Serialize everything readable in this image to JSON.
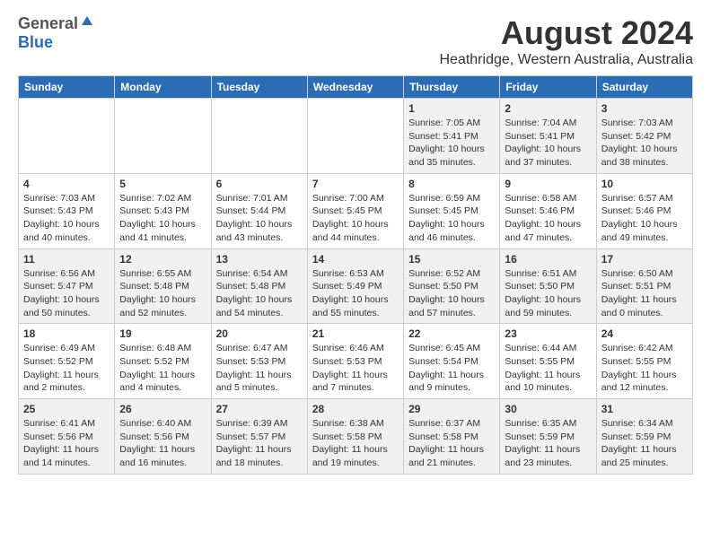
{
  "header": {
    "logo_general": "General",
    "logo_blue": "Blue",
    "month_year": "August 2024",
    "location": "Heathridge, Western Australia, Australia"
  },
  "days_of_week": [
    "Sunday",
    "Monday",
    "Tuesday",
    "Wednesday",
    "Thursday",
    "Friday",
    "Saturday"
  ],
  "weeks": [
    [
      {
        "day": "",
        "info": ""
      },
      {
        "day": "",
        "info": ""
      },
      {
        "day": "",
        "info": ""
      },
      {
        "day": "",
        "info": ""
      },
      {
        "day": "1",
        "info": "Sunrise: 7:05 AM\nSunset: 5:41 PM\nDaylight: 10 hours\nand 35 minutes."
      },
      {
        "day": "2",
        "info": "Sunrise: 7:04 AM\nSunset: 5:41 PM\nDaylight: 10 hours\nand 37 minutes."
      },
      {
        "day": "3",
        "info": "Sunrise: 7:03 AM\nSunset: 5:42 PM\nDaylight: 10 hours\nand 38 minutes."
      }
    ],
    [
      {
        "day": "4",
        "info": "Sunrise: 7:03 AM\nSunset: 5:43 PM\nDaylight: 10 hours\nand 40 minutes."
      },
      {
        "day": "5",
        "info": "Sunrise: 7:02 AM\nSunset: 5:43 PM\nDaylight: 10 hours\nand 41 minutes."
      },
      {
        "day": "6",
        "info": "Sunrise: 7:01 AM\nSunset: 5:44 PM\nDaylight: 10 hours\nand 43 minutes."
      },
      {
        "day": "7",
        "info": "Sunrise: 7:00 AM\nSunset: 5:45 PM\nDaylight: 10 hours\nand 44 minutes."
      },
      {
        "day": "8",
        "info": "Sunrise: 6:59 AM\nSunset: 5:45 PM\nDaylight: 10 hours\nand 46 minutes."
      },
      {
        "day": "9",
        "info": "Sunrise: 6:58 AM\nSunset: 5:46 PM\nDaylight: 10 hours\nand 47 minutes."
      },
      {
        "day": "10",
        "info": "Sunrise: 6:57 AM\nSunset: 5:46 PM\nDaylight: 10 hours\nand 49 minutes."
      }
    ],
    [
      {
        "day": "11",
        "info": "Sunrise: 6:56 AM\nSunset: 5:47 PM\nDaylight: 10 hours\nand 50 minutes."
      },
      {
        "day": "12",
        "info": "Sunrise: 6:55 AM\nSunset: 5:48 PM\nDaylight: 10 hours\nand 52 minutes."
      },
      {
        "day": "13",
        "info": "Sunrise: 6:54 AM\nSunset: 5:48 PM\nDaylight: 10 hours\nand 54 minutes."
      },
      {
        "day": "14",
        "info": "Sunrise: 6:53 AM\nSunset: 5:49 PM\nDaylight: 10 hours\nand 55 minutes."
      },
      {
        "day": "15",
        "info": "Sunrise: 6:52 AM\nSunset: 5:50 PM\nDaylight: 10 hours\nand 57 minutes."
      },
      {
        "day": "16",
        "info": "Sunrise: 6:51 AM\nSunset: 5:50 PM\nDaylight: 10 hours\nand 59 minutes."
      },
      {
        "day": "17",
        "info": "Sunrise: 6:50 AM\nSunset: 5:51 PM\nDaylight: 11 hours\nand 0 minutes."
      }
    ],
    [
      {
        "day": "18",
        "info": "Sunrise: 6:49 AM\nSunset: 5:52 PM\nDaylight: 11 hours\nand 2 minutes."
      },
      {
        "day": "19",
        "info": "Sunrise: 6:48 AM\nSunset: 5:52 PM\nDaylight: 11 hours\nand 4 minutes."
      },
      {
        "day": "20",
        "info": "Sunrise: 6:47 AM\nSunset: 5:53 PM\nDaylight: 11 hours\nand 5 minutes."
      },
      {
        "day": "21",
        "info": "Sunrise: 6:46 AM\nSunset: 5:53 PM\nDaylight: 11 hours\nand 7 minutes."
      },
      {
        "day": "22",
        "info": "Sunrise: 6:45 AM\nSunset: 5:54 PM\nDaylight: 11 hours\nand 9 minutes."
      },
      {
        "day": "23",
        "info": "Sunrise: 6:44 AM\nSunset: 5:55 PM\nDaylight: 11 hours\nand 10 minutes."
      },
      {
        "day": "24",
        "info": "Sunrise: 6:42 AM\nSunset: 5:55 PM\nDaylight: 11 hours\nand 12 minutes."
      }
    ],
    [
      {
        "day": "25",
        "info": "Sunrise: 6:41 AM\nSunset: 5:56 PM\nDaylight: 11 hours\nand 14 minutes."
      },
      {
        "day": "26",
        "info": "Sunrise: 6:40 AM\nSunset: 5:56 PM\nDaylight: 11 hours\nand 16 minutes."
      },
      {
        "day": "27",
        "info": "Sunrise: 6:39 AM\nSunset: 5:57 PM\nDaylight: 11 hours\nand 18 minutes."
      },
      {
        "day": "28",
        "info": "Sunrise: 6:38 AM\nSunset: 5:58 PM\nDaylight: 11 hours\nand 19 minutes."
      },
      {
        "day": "29",
        "info": "Sunrise: 6:37 AM\nSunset: 5:58 PM\nDaylight: 11 hours\nand 21 minutes."
      },
      {
        "day": "30",
        "info": "Sunrise: 6:35 AM\nSunset: 5:59 PM\nDaylight: 11 hours\nand 23 minutes."
      },
      {
        "day": "31",
        "info": "Sunrise: 6:34 AM\nSunset: 5:59 PM\nDaylight: 11 hours\nand 25 minutes."
      }
    ]
  ]
}
